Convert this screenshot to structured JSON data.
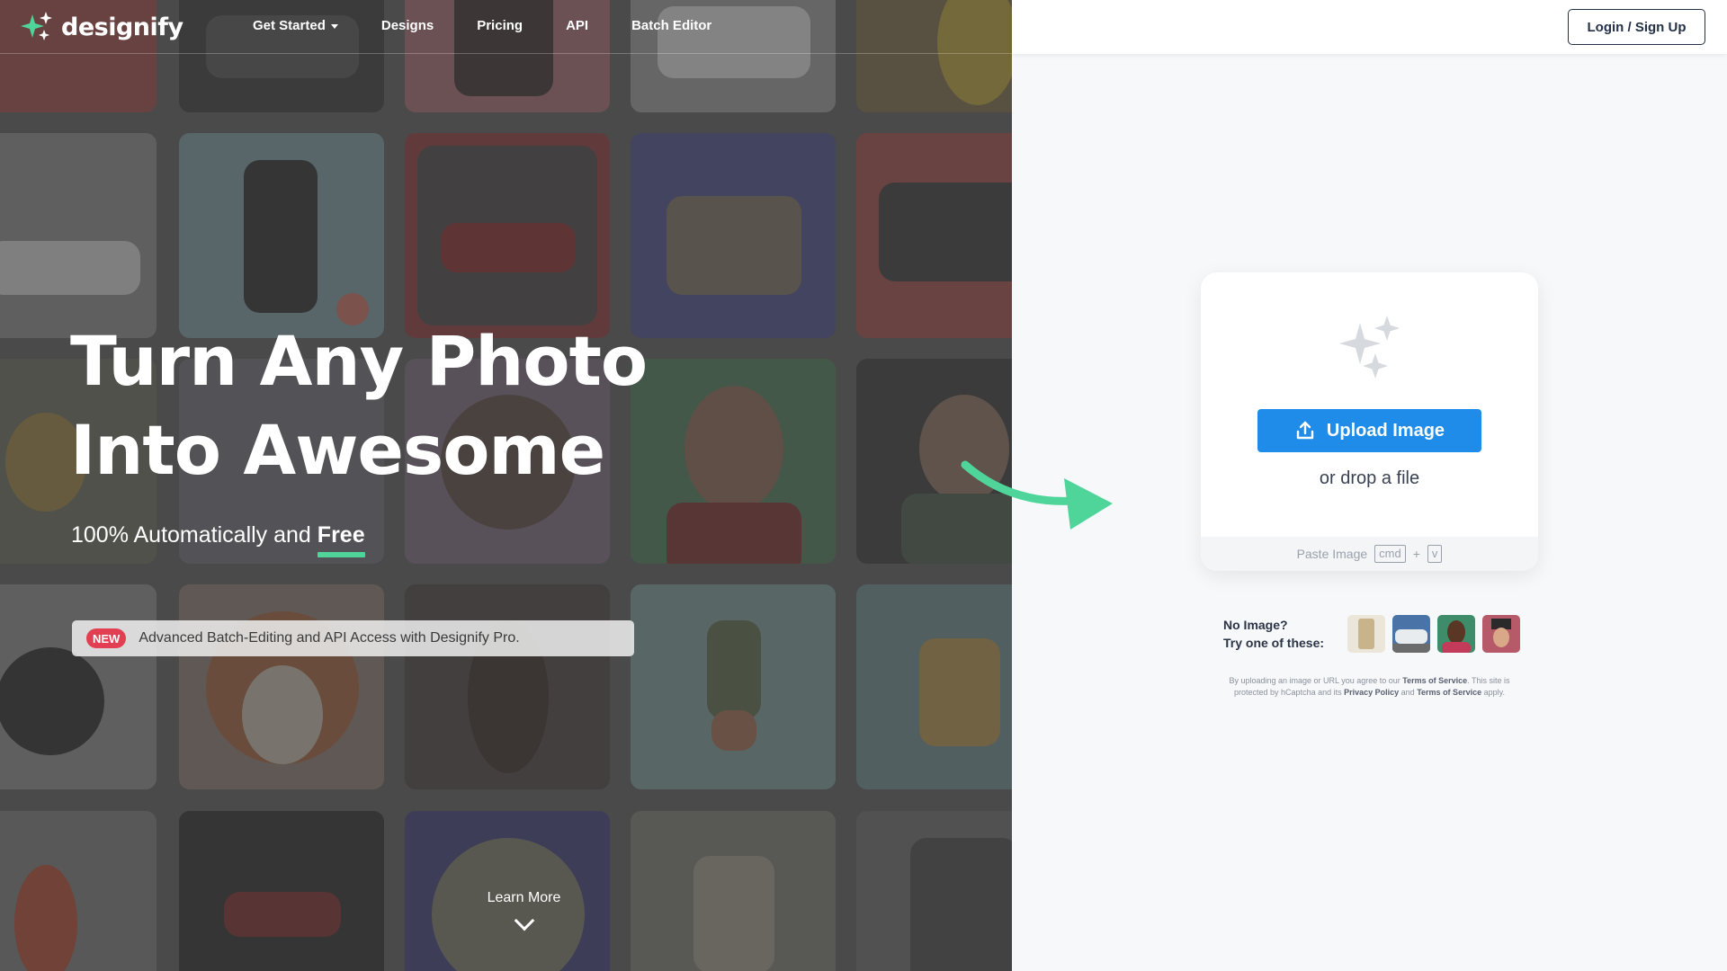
{
  "brand": {
    "name": "designify",
    "accent": "#4fd59a"
  },
  "nav": {
    "items": [
      {
        "label": "Get Started",
        "has_caret": true
      },
      {
        "label": "Designs"
      },
      {
        "label": "Pricing"
      },
      {
        "label": "API"
      },
      {
        "label": "Batch Editor"
      }
    ],
    "login_label": "Login / Sign Up"
  },
  "hero": {
    "title_line1": "Turn Any Photo",
    "title_line2": "Into Awesome",
    "subtitle_prefix": "100% Automatically and",
    "subtitle_emphasis": "Free",
    "banner_badge": "NEW",
    "banner_text": "Advanced Batch-Editing and API Access with Designify Pro.",
    "learn_more": "Learn More"
  },
  "upload": {
    "button_label": "Upload Image",
    "drop_text": "or drop a file",
    "paste_label": "Paste Image",
    "paste_key1": "cmd",
    "paste_plus": "+",
    "paste_key2": "v",
    "button_color": "#1e8ce8"
  },
  "samples": {
    "label_line1": "No Image?",
    "label_line2": "Try one of these:",
    "thumbs": [
      "sample-product",
      "sample-car",
      "sample-person",
      "sample-woman"
    ]
  },
  "legal": {
    "text1": "By uploading an image or URL you agree to our",
    "tos": "Terms of Service",
    "text2": ". This site is protected by hCaptcha and its",
    "privacy": "Privacy Policy",
    "text3": "and",
    "tos2": "Terms of Service",
    "text4": "apply."
  }
}
